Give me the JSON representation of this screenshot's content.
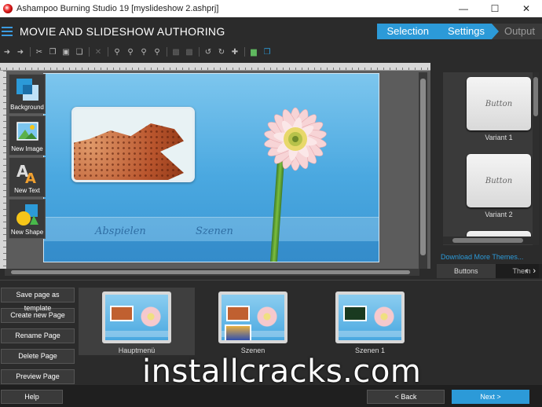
{
  "window": {
    "title": "Ashampoo Burning Studio 19 [myslideshow 2.ashprj]",
    "minimize": "—",
    "maximize": "☐",
    "close": "✕"
  },
  "header": {
    "title": "MOVIE AND SLIDESHOW AUTHORING"
  },
  "steps": [
    {
      "label": "Selection"
    },
    {
      "label": "Settings"
    },
    {
      "label": "Output"
    }
  ],
  "tools": [
    {
      "label": "Background"
    },
    {
      "label": "New Image"
    },
    {
      "label": "New Text"
    },
    {
      "label": "New Shape"
    }
  ],
  "stage": {
    "menu_item_1": "Abspielen",
    "menu_item_2": "Szenen"
  },
  "themes": {
    "variants": [
      {
        "button_text": "Button",
        "label": "Variant 1"
      },
      {
        "button_text": "Button",
        "label": "Variant 2"
      }
    ],
    "download_link": "Download More Themes...",
    "tabs": [
      "Buttons",
      "Them"
    ]
  },
  "page_buttons": [
    "Save page as template",
    "Create new Page",
    "Rename Page",
    "Delete Page",
    "Preview Page"
  ],
  "pages": [
    {
      "label": "Hauptmenü"
    },
    {
      "label": "Szenen"
    },
    {
      "label": "Szenen 1"
    }
  ],
  "watermark": "installcracks.com",
  "footer": {
    "help": "Help",
    "back": "< Back",
    "next": "Next >"
  }
}
